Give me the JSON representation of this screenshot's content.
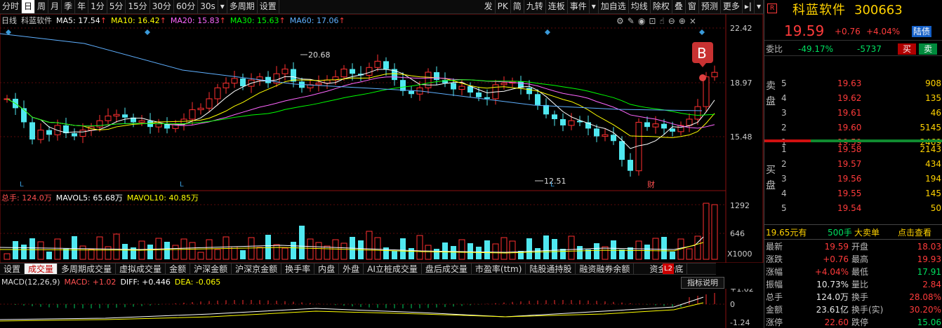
{
  "toolbar": {
    "left": [
      "分时",
      "日",
      "周",
      "月",
      "季",
      "年",
      "1分",
      "5分",
      "15分",
      "30分",
      "60分",
      "30s",
      "▾",
      "多周期",
      "设置"
    ],
    "selected": "日",
    "right": [
      "发",
      "PK",
      "简",
      "九转",
      "连板",
      "事件",
      "▾",
      "加自选",
      "均线",
      "除权",
      "叠",
      "窗",
      "预测",
      "更多",
      "▸|",
      "▾"
    ]
  },
  "kline": {
    "period": "日线",
    "name": "科蓝软件",
    "ma": [
      {
        "label": "MA5: 17.54",
        "color": "#ffffff"
      },
      {
        "label": "MA10: 16.42",
        "color": "#ffff00"
      },
      {
        "label": "MA20: 15.83",
        "color": "#ff66ff"
      },
      {
        "label": "MA30: 15.63",
        "color": "#00ff00"
      },
      {
        "label": "MA60: 17.06",
        "color": "#5fb0ff"
      }
    ],
    "yticks": [
      "22.42",
      "18.97",
      "15.48"
    ],
    "ann_high": "20.68",
    "ann_low": "12.51",
    "signal": "B",
    "markers": [
      "L",
      "L",
      "L"
    ],
    "fin": "财"
  },
  "volume": {
    "legend": [
      {
        "label": "总手: 124.0万",
        "color": "#ff5050"
      },
      {
        "label": "MAVOL5: 65.68万",
        "color": "#ffffff"
      },
      {
        "label": "MAVOL10: 40.85万",
        "color": "#ffff00"
      }
    ],
    "yticks": [
      "1292",
      "646"
    ],
    "unit": "X1000"
  },
  "tabs": [
    "设置",
    "成交量",
    "多周期成交量",
    "虚拟成交量",
    "金额",
    "沪深金额",
    "沪深京金额",
    "换手率",
    "内盘",
    "外盘",
    "AI立桩成交量",
    "盘后成交量",
    "市盈率(ttm)",
    "陆股通持股",
    "融资融券余额",
    "资金抄底"
  ],
  "tab_selected": "成交量",
  "l2": "L2",
  "macd": {
    "legend": [
      {
        "label": "MACD(12,26,9)",
        "color": "#dddddd"
      },
      {
        "label": "MACD: +1.02",
        "color": "#ff5050"
      },
      {
        "label": "DIFF: +0.446",
        "color": "#ffffff"
      },
      {
        "label": "DEA: -0.065",
        "color": "#ffff00"
      }
    ],
    "yticks": [
      "+1.02",
      "0",
      "-1.24"
    ],
    "help": "指标说明"
  },
  "stock": {
    "badge": "R",
    "name": "科蓝软件",
    "code": "300663",
    "price": "19.59",
    "change": "+0.76",
    "pct": "+4.04%",
    "tag": "陆债",
    "wb_label": "委比",
    "wb_pct": "-49.17%",
    "wb_val": "-5737",
    "buy": "买",
    "sell": "卖"
  },
  "ask": [
    {
      "n": "5",
      "p": "19.63",
      "v": "908"
    },
    {
      "n": "4",
      "p": "19.62",
      "v": "135"
    },
    {
      "n": "3",
      "p": "19.61",
      "v": "46"
    },
    {
      "n": "2",
      "p": "19.60",
      "v": "5145"
    },
    {
      "n": "1",
      "p": "19.59",
      "v": "2469"
    }
  ],
  "bid": [
    {
      "n": "1",
      "p": "19.58",
      "v": "2143"
    },
    {
      "n": "2",
      "p": "19.57",
      "v": "434"
    },
    {
      "n": "3",
      "p": "19.56",
      "v": "194"
    },
    {
      "n": "4",
      "p": "19.55",
      "v": "145"
    },
    {
      "n": "5",
      "p": "19.54",
      "v": "50"
    }
  ],
  "ask_label": [
    "卖",
    "盘"
  ],
  "bid_label": [
    "买",
    "盘"
  ],
  "bigorder": {
    "price": "19.65元有",
    "vol": "500手",
    "label": "大卖单",
    "link": "点击查看"
  },
  "stats": [
    {
      "l": "最新",
      "v": "19.59",
      "vc": "red",
      "l2": "开盘",
      "v2": "18.03",
      "v2c": "red"
    },
    {
      "l": "涨跌",
      "v": "+0.76",
      "vc": "red",
      "l2": "最高",
      "v2": "19.93",
      "v2c": "red"
    },
    {
      "l": "涨幅",
      "v": "+4.04%",
      "vc": "red",
      "l2": "最低",
      "v2": "17.91",
      "v2c": "grn"
    },
    {
      "l": "振幅",
      "v": "10.73%",
      "vc": "wht",
      "l2": "量比",
      "v2": "2.84",
      "v2c": "red"
    },
    {
      "l": "总手",
      "v": "124.0万",
      "vc": "wht",
      "l2": "换手",
      "v2": "28.08%",
      "v2c": "red"
    },
    {
      "l": "金额",
      "v": "23.61亿",
      "vc": "wht",
      "l2": "换手(实)",
      "v2": "30.20%",
      "v2c": "red"
    },
    {
      "l": "涨停",
      "v": "22.60",
      "vc": "red",
      "l2": "跌停",
      "v2": "15.06",
      "v2c": "grn"
    }
  ]
}
